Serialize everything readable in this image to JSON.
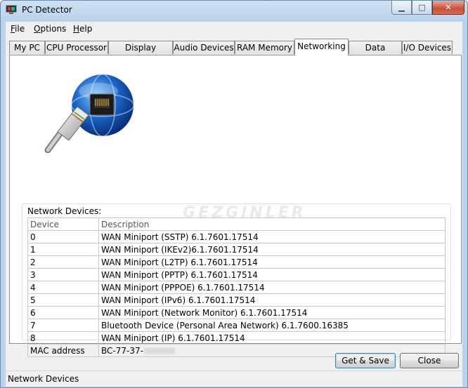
{
  "window": {
    "title": "PC Detector"
  },
  "menu": [
    {
      "label": "File",
      "key": "F",
      "rest": "ile"
    },
    {
      "label": "Options",
      "key": "O",
      "rest": "ptions"
    },
    {
      "label": "Help",
      "key": "H",
      "rest": "elp"
    }
  ],
  "tabs": [
    "My PC",
    "CPU Processor",
    "Display Devices",
    "Audio Devices",
    "RAM Memory",
    "Networking",
    "Data Storage",
    "I/O Devices"
  ],
  "active_tab": "Networking",
  "network": {
    "group_label": "Network Devices:",
    "watermark": "GEZGİNLER",
    "columns": [
      "Device",
      "Description"
    ],
    "rows": [
      [
        "0",
        "WAN Miniport (SSTP) 6.1.7601.17514"
      ],
      [
        "1",
        "WAN Miniport (IKEv2)6.1.7601.17514"
      ],
      [
        "2",
        "WAN Miniport (L2TP) 6.1.7601.17514"
      ],
      [
        "3",
        "WAN Miniport (PPTP) 6.1.7601.17514"
      ],
      [
        "4",
        "WAN Miniport (PPPOE) 6.1.7601.17514"
      ],
      [
        "5",
        "WAN Miniport (IPv6) 6.1.7601.17514"
      ],
      [
        "6",
        "WAN Miniport (Network Monitor) 6.1.7601.17514"
      ],
      [
        "7",
        "Bluetooth Device (Personal Area Network) 6.1.7600.16385"
      ],
      [
        "8",
        "WAN Miniport (IP) 6.1.7601.17514"
      ]
    ],
    "mac_label": "MAC address",
    "mac_value": "BC-77-37-"
  },
  "buttons": {
    "get_save": "Get & Save",
    "close": "Close"
  },
  "status": "Network Devices",
  "colors": {
    "title_bar": "#b9d1ea",
    "close_button": "#c7513c",
    "globe": "#1a63c4"
  }
}
